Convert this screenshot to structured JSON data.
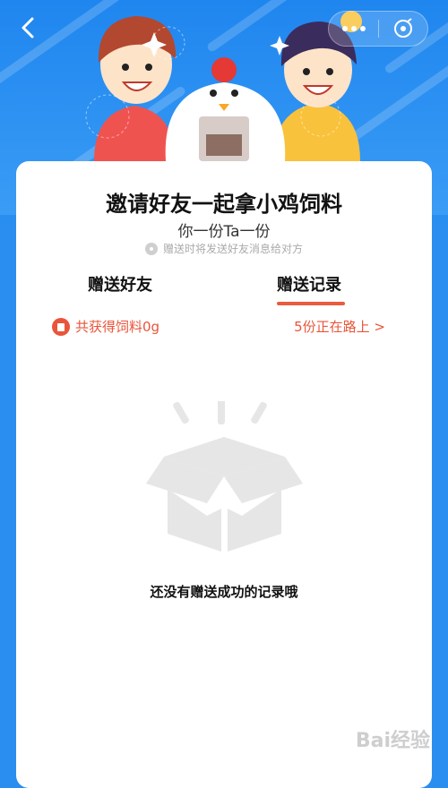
{
  "header": {
    "back_icon": "chevron-left-icon",
    "more_icon": "more-dots-icon",
    "close_icon": "close-circle-icon"
  },
  "card": {
    "title": "邀请好友一起拿小鸡饲料",
    "subtitle": "你一份Ta一份",
    "hint": "赠送时将发送好友消息给对方",
    "tabs": [
      {
        "label": "赠送好友",
        "active": false
      },
      {
        "label": "赠送记录",
        "active": true
      }
    ],
    "earned_text": "共获得饲料0g",
    "on_the_way_text": "5份正在路上 >",
    "empty_text": "还没有赠送成功的记录哦"
  },
  "watermark": "Bai经验",
  "colors": {
    "background_blue": "#2a8ef0",
    "accent_red": "#e9553a",
    "card": "#ffffff"
  }
}
